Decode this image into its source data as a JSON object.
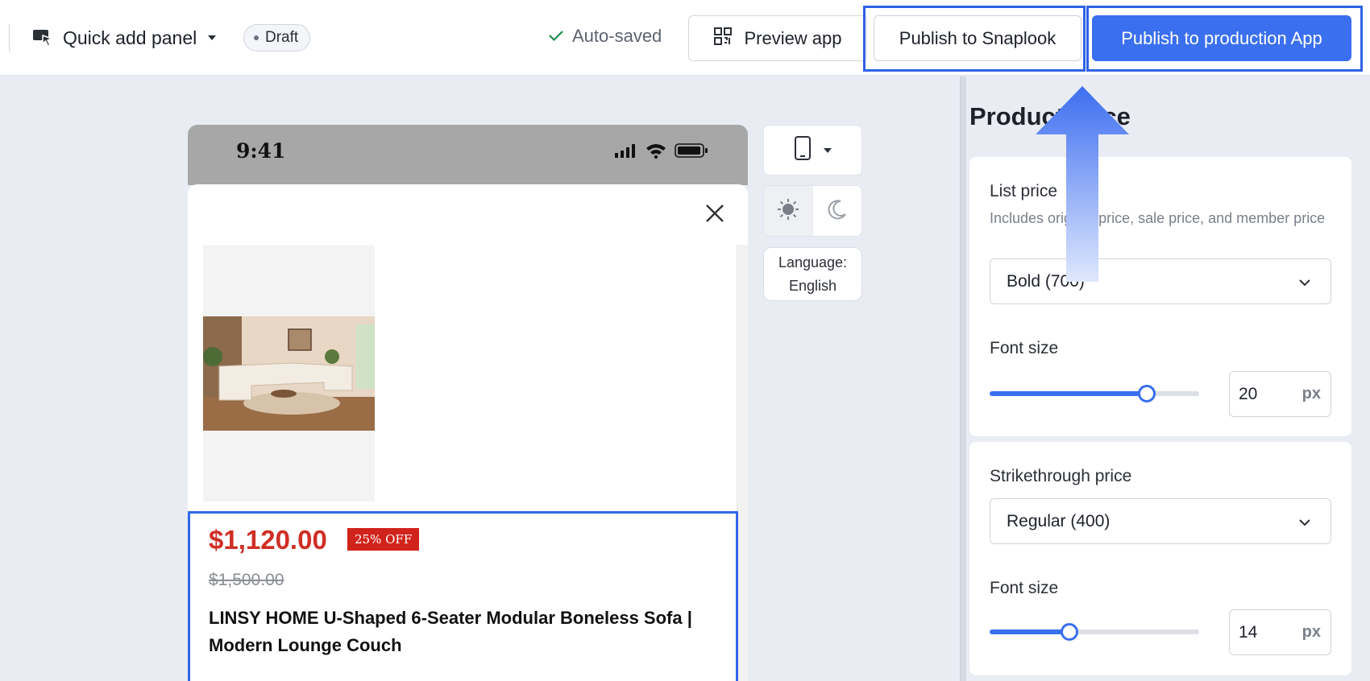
{
  "topbar": {
    "panel_selector": {
      "label": "Quick add panel",
      "icon": "cursor-panel-icon"
    },
    "status_badge": "Draft",
    "autosave_status": "Auto-saved",
    "preview_button": "Preview app",
    "publish_snaplook_button": "Publish to Snaplook",
    "publish_production_button": "Publish to production App"
  },
  "phone": {
    "status_time": "9:41",
    "product": {
      "price": "$1,120.00",
      "discount_badge": "25% OFF",
      "original_price": "$1,500.00",
      "title": "LINSY HOME U-Shaped 6-Seater Modular Boneless Sofa | Modern Lounge Couch"
    }
  },
  "preview_controls": {
    "device": "mobile-phone-icon",
    "theme_options": [
      "light-sun-icon",
      "dark-moon-icon"
    ],
    "language_label": "Language:",
    "language_value": "English"
  },
  "right_panel": {
    "title": "Product price",
    "list_price": {
      "label": "List price",
      "help": "Includes original price, sale price, and member price",
      "weight_value": "Bold (700)",
      "font_size_label": "Font size",
      "font_size_value": "20",
      "unit": "px",
      "slider_fraction": 0.75
    },
    "strikethrough_price": {
      "label": "Strikethrough price",
      "weight_value": "Regular (400)",
      "font_size_label": "Font size",
      "font_size_value": "14",
      "unit": "px",
      "slider_fraction": 0.38
    }
  },
  "colors": {
    "accent": "#3a6ff0",
    "highlight": "#2f62e6",
    "price_red": "#cf2f26",
    "badge_red": "#d0231b",
    "canvas_bg": "#e9ecf3"
  }
}
